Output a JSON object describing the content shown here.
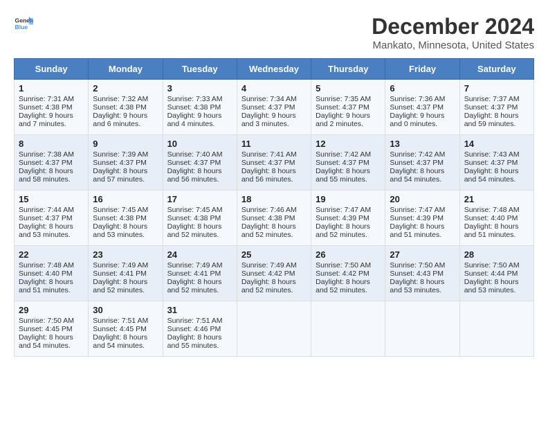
{
  "header": {
    "logo_general": "General",
    "logo_blue": "Blue",
    "title": "December 2024",
    "subtitle": "Mankato, Minnesota, United States"
  },
  "calendar": {
    "days_of_week": [
      "Sunday",
      "Monday",
      "Tuesday",
      "Wednesday",
      "Thursday",
      "Friday",
      "Saturday"
    ],
    "weeks": [
      [
        {
          "day": "1",
          "sunrise": "7:31 AM",
          "sunset": "4:38 PM",
          "daylight": "9 hours and 7 minutes."
        },
        {
          "day": "2",
          "sunrise": "7:32 AM",
          "sunset": "4:38 PM",
          "daylight": "9 hours and 6 minutes."
        },
        {
          "day": "3",
          "sunrise": "7:33 AM",
          "sunset": "4:38 PM",
          "daylight": "9 hours and 4 minutes."
        },
        {
          "day": "4",
          "sunrise": "7:34 AM",
          "sunset": "4:37 PM",
          "daylight": "9 hours and 3 minutes."
        },
        {
          "day": "5",
          "sunrise": "7:35 AM",
          "sunset": "4:37 PM",
          "daylight": "9 hours and 2 minutes."
        },
        {
          "day": "6",
          "sunrise": "7:36 AM",
          "sunset": "4:37 PM",
          "daylight": "9 hours and 0 minutes."
        },
        {
          "day": "7",
          "sunrise": "7:37 AM",
          "sunset": "4:37 PM",
          "daylight": "8 hours and 59 minutes."
        }
      ],
      [
        {
          "day": "8",
          "sunrise": "7:38 AM",
          "sunset": "4:37 PM",
          "daylight": "8 hours and 58 minutes."
        },
        {
          "day": "9",
          "sunrise": "7:39 AM",
          "sunset": "4:37 PM",
          "daylight": "8 hours and 57 minutes."
        },
        {
          "day": "10",
          "sunrise": "7:40 AM",
          "sunset": "4:37 PM",
          "daylight": "8 hours and 56 minutes."
        },
        {
          "day": "11",
          "sunrise": "7:41 AM",
          "sunset": "4:37 PM",
          "daylight": "8 hours and 56 minutes."
        },
        {
          "day": "12",
          "sunrise": "7:42 AM",
          "sunset": "4:37 PM",
          "daylight": "8 hours and 55 minutes."
        },
        {
          "day": "13",
          "sunrise": "7:42 AM",
          "sunset": "4:37 PM",
          "daylight": "8 hours and 54 minutes."
        },
        {
          "day": "14",
          "sunrise": "7:43 AM",
          "sunset": "4:37 PM",
          "daylight": "8 hours and 54 minutes."
        }
      ],
      [
        {
          "day": "15",
          "sunrise": "7:44 AM",
          "sunset": "4:37 PM",
          "daylight": "8 hours and 53 minutes."
        },
        {
          "day": "16",
          "sunrise": "7:45 AM",
          "sunset": "4:38 PM",
          "daylight": "8 hours and 53 minutes."
        },
        {
          "day": "17",
          "sunrise": "7:45 AM",
          "sunset": "4:38 PM",
          "daylight": "8 hours and 52 minutes."
        },
        {
          "day": "18",
          "sunrise": "7:46 AM",
          "sunset": "4:38 PM",
          "daylight": "8 hours and 52 minutes."
        },
        {
          "day": "19",
          "sunrise": "7:47 AM",
          "sunset": "4:39 PM",
          "daylight": "8 hours and 52 minutes."
        },
        {
          "day": "20",
          "sunrise": "7:47 AM",
          "sunset": "4:39 PM",
          "daylight": "8 hours and 51 minutes."
        },
        {
          "day": "21",
          "sunrise": "7:48 AM",
          "sunset": "4:40 PM",
          "daylight": "8 hours and 51 minutes."
        }
      ],
      [
        {
          "day": "22",
          "sunrise": "7:48 AM",
          "sunset": "4:40 PM",
          "daylight": "8 hours and 51 minutes."
        },
        {
          "day": "23",
          "sunrise": "7:49 AM",
          "sunset": "4:41 PM",
          "daylight": "8 hours and 52 minutes."
        },
        {
          "day": "24",
          "sunrise": "7:49 AM",
          "sunset": "4:41 PM",
          "daylight": "8 hours and 52 minutes."
        },
        {
          "day": "25",
          "sunrise": "7:49 AM",
          "sunset": "4:42 PM",
          "daylight": "8 hours and 52 minutes."
        },
        {
          "day": "26",
          "sunrise": "7:50 AM",
          "sunset": "4:42 PM",
          "daylight": "8 hours and 52 minutes."
        },
        {
          "day": "27",
          "sunrise": "7:50 AM",
          "sunset": "4:43 PM",
          "daylight": "8 hours and 53 minutes."
        },
        {
          "day": "28",
          "sunrise": "7:50 AM",
          "sunset": "4:44 PM",
          "daylight": "8 hours and 53 minutes."
        }
      ],
      [
        {
          "day": "29",
          "sunrise": "7:50 AM",
          "sunset": "4:45 PM",
          "daylight": "8 hours and 54 minutes."
        },
        {
          "day": "30",
          "sunrise": "7:51 AM",
          "sunset": "4:45 PM",
          "daylight": "8 hours and 54 minutes."
        },
        {
          "day": "31",
          "sunrise": "7:51 AM",
          "sunset": "4:46 PM",
          "daylight": "8 hours and 55 minutes."
        },
        null,
        null,
        null,
        null
      ]
    ]
  }
}
